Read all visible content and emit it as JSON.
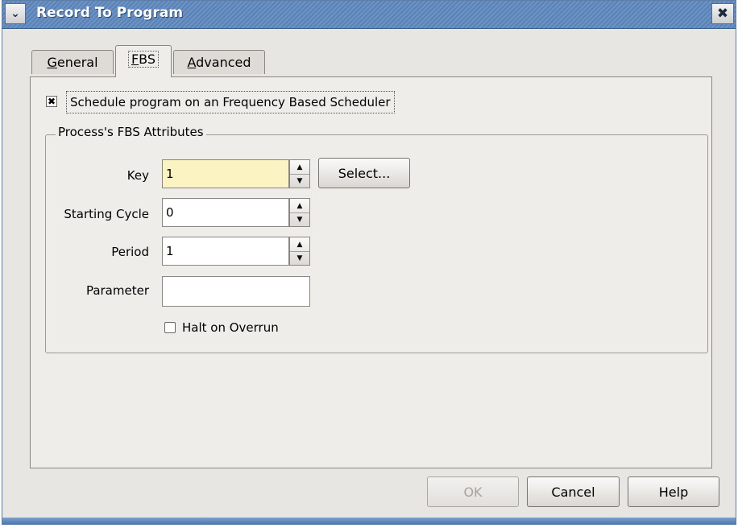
{
  "window": {
    "title": "Record To Program",
    "menu_icon": "chevron-down-icon",
    "close_icon": "close-icon"
  },
  "tabs": [
    {
      "mnemonic": "G",
      "rest": "eneral",
      "active": false
    },
    {
      "mnemonic": "F",
      "rest": "BS",
      "active": true
    },
    {
      "mnemonic": "A",
      "rest": "dvanced",
      "active": false
    }
  ],
  "fbs": {
    "schedule_checkbox": {
      "checked": true,
      "label": "Schedule program on an Frequency Based Scheduler"
    },
    "group_title": "Process's FBS Attributes",
    "key": {
      "label": "Key",
      "value": "1"
    },
    "select_button": "Select...",
    "starting_cycle": {
      "label": "Starting Cycle",
      "value": "0"
    },
    "period": {
      "label": "Period",
      "value": "1"
    },
    "parameter": {
      "label": "Parameter",
      "value": ""
    },
    "halt_on_overrun": {
      "checked": false,
      "label": "Halt on Overrun"
    }
  },
  "buttons": {
    "ok": "OK",
    "cancel": "Cancel",
    "help": "Help"
  },
  "colors": {
    "titlebar": "#6d93c4",
    "focused_input": "#fbf3c2",
    "dialog_bg": "#e8e6e3"
  }
}
